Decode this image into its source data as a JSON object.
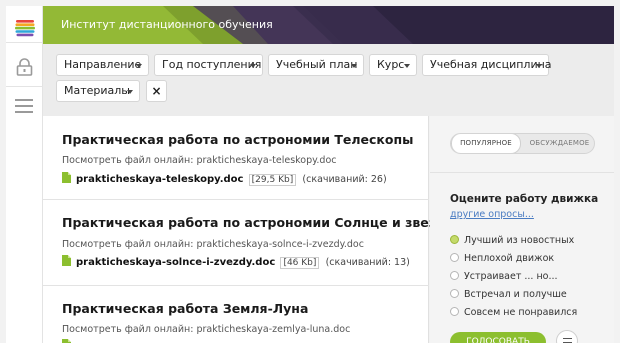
{
  "header": {
    "title": "Институт дистанционного обучения"
  },
  "filters": {
    "items": [
      "Направление",
      "Год поступления",
      "Учебный план",
      "Курс",
      "Учебная дисциплина",
      "Материалы"
    ],
    "clear_label": "×"
  },
  "items": [
    {
      "title": "Практическая работа по астрономии Телескопы",
      "view_text": "Посмотреть файл онлайн: prakticheskaya-teleskopy.doc",
      "file_name": "prakticheskaya-teleskopy.doc",
      "file_size": "[29,5 Kb]",
      "downloads": "(скачиваний: 26)"
    },
    {
      "title": "Практическая работа по астрономии Солнце и звезды",
      "view_text": "Посмотреть файл онлайн: prakticheskaya-solnce-i-zvezdy.doc",
      "file_name": "prakticheskaya-solnce-i-zvezdy.doc",
      "file_size": "[46 Kb]",
      "downloads": "(скачиваний: 13)"
    },
    {
      "title": "Практическая работа Земля-Луна",
      "view_text": "Посмотреть файл онлайн: prakticheskaya-zemlya-luna.doc",
      "file_name": "",
      "file_size": "",
      "downloads": ""
    }
  ],
  "sidebar": {
    "tabs": [
      "ПОПУЛЯРНОЕ",
      "ОБСУЖДАЕМОЕ"
    ],
    "poll": {
      "title": "Оцените работу движка",
      "other_link": "другие опросы...",
      "options": [
        "Лучший из новостных",
        "Неплохой движок",
        "Устраивает ... но...",
        "Встречал и получше",
        "Совсем не понравился"
      ],
      "selected_index": 0,
      "vote_label": "ГОЛОСОВАТЬ"
    }
  },
  "colors": {
    "accent_green": "#8cbf2f",
    "header_dark": "#2d2440",
    "link_blue": "#4a7cc2"
  },
  "icons": [
    "logo-icon",
    "lock-icon",
    "menu-icon",
    "file-icon",
    "caret-down-icon",
    "results-icon"
  ]
}
